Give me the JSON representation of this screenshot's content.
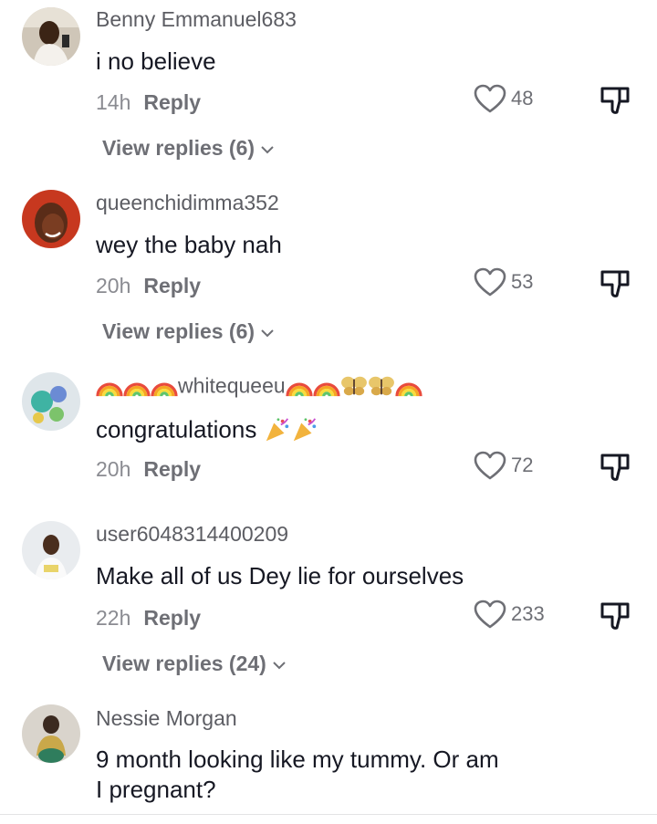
{
  "comments": [
    {
      "username": "Benny Emmanuel683",
      "text": "i no believe",
      "time": "14h",
      "reply_label": "Reply",
      "likes": "48",
      "view_replies": "View replies (6)"
    },
    {
      "username": "queenchidimma352",
      "text": "wey the baby nah",
      "time": "20h",
      "reply_label": "Reply",
      "likes": "53",
      "view_replies": "View replies (6)"
    },
    {
      "username_text": "whitequeeu",
      "text": "congratulations",
      "time": "20h",
      "reply_label": "Reply",
      "likes": "72"
    },
    {
      "username": "user6048314400209",
      "text": "Make all of us Dey lie for ourselves",
      "time": "22h",
      "reply_label": "Reply",
      "likes": "233",
      "view_replies": "View replies (24)"
    },
    {
      "username": "Nessie Morgan",
      "text_line1": "9 month looking like my tummy. Or am",
      "text_line2": "I pregnant?"
    }
  ],
  "icons": {
    "like": "heart-outline-icon",
    "dislike": "thumbs-down-icon",
    "expand": "chevron-down-icon"
  },
  "colors": {
    "text": "#161823",
    "username": "#5c5d63",
    "secondary": "#8a8b91"
  }
}
